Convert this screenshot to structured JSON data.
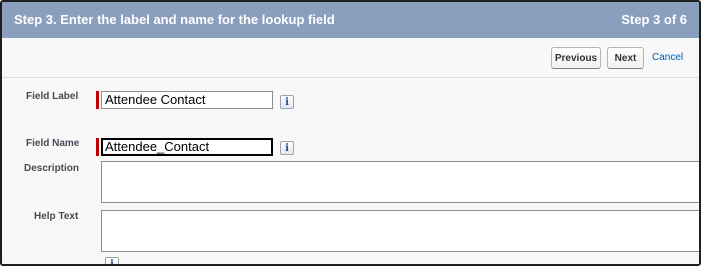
{
  "header": {
    "title": "Step 3. Enter the label and name for the lookup field",
    "step": "Step 3 of 6"
  },
  "toolbar": {
    "previous_label": "Previous",
    "next_label": "Next",
    "cancel_label": "Cancel"
  },
  "form": {
    "field_label": {
      "label": "Field Label",
      "value": "Attendee Contact",
      "required": true,
      "info": "i"
    },
    "field_name": {
      "label": "Field Name",
      "value": "Attendee_Contact",
      "required": true,
      "info": "i"
    },
    "description": {
      "label": "Description",
      "value": ""
    },
    "help_text": {
      "label": "Help Text",
      "value": "",
      "info": "i"
    }
  },
  "colors": {
    "header_bg": "#8a9ebe",
    "required_marker": "#c00000",
    "link": "#015ba7"
  }
}
